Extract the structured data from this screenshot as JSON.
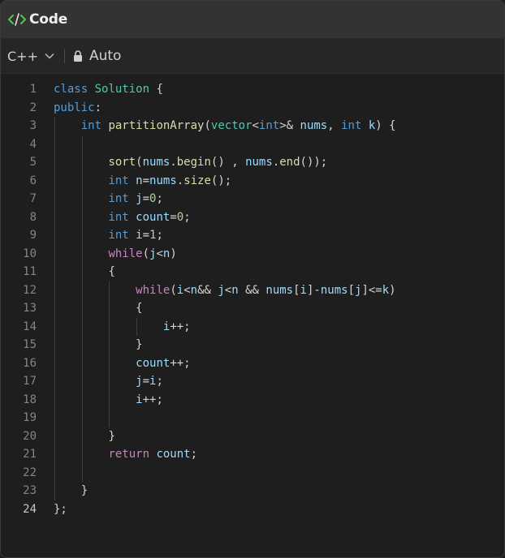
{
  "header": {
    "title": "Code",
    "icon": "code-icon"
  },
  "toolbar": {
    "language": "C++",
    "mode": "Auto"
  },
  "editor": {
    "active_line": 24,
    "lines": [
      {
        "n": "1",
        "indent": 0,
        "tokens": [
          [
            "kw",
            "class"
          ],
          [
            "pl",
            " "
          ],
          [
            "type",
            "Solution"
          ],
          [
            "pl",
            " {"
          ]
        ]
      },
      {
        "n": "2",
        "indent": 0,
        "tokens": [
          [
            "kw",
            "public"
          ],
          [
            "pl",
            ":"
          ]
        ]
      },
      {
        "n": "3",
        "indent": 1,
        "tokens": [
          [
            "kw",
            "int"
          ],
          [
            "pl",
            " "
          ],
          [
            "fn",
            "partitionArray"
          ],
          [
            "pl",
            "("
          ],
          [
            "type",
            "vector"
          ],
          [
            "pl",
            "<"
          ],
          [
            "kw",
            "int"
          ],
          [
            "pl",
            ">& "
          ],
          [
            "var",
            "nums"
          ],
          [
            "pl",
            ", "
          ],
          [
            "kw",
            "int"
          ],
          [
            "pl",
            " "
          ],
          [
            "var",
            "k"
          ],
          [
            "pl",
            ") {"
          ]
        ]
      },
      {
        "n": "4",
        "indent": 2,
        "tokens": []
      },
      {
        "n": "5",
        "indent": 2,
        "tokens": [
          [
            "fn",
            "sort"
          ],
          [
            "pl",
            "("
          ],
          [
            "var",
            "nums"
          ],
          [
            "pl",
            "."
          ],
          [
            "fn",
            "begin"
          ],
          [
            "pl",
            "() , "
          ],
          [
            "var",
            "nums"
          ],
          [
            "pl",
            "."
          ],
          [
            "fn",
            "end"
          ],
          [
            "pl",
            "());"
          ]
        ]
      },
      {
        "n": "6",
        "indent": 2,
        "tokens": [
          [
            "kw",
            "int"
          ],
          [
            "pl",
            " "
          ],
          [
            "var",
            "n"
          ],
          [
            "pl",
            "="
          ],
          [
            "var",
            "nums"
          ],
          [
            "pl",
            "."
          ],
          [
            "fn",
            "size"
          ],
          [
            "pl",
            "();"
          ]
        ]
      },
      {
        "n": "7",
        "indent": 2,
        "tokens": [
          [
            "kw",
            "int"
          ],
          [
            "pl",
            " "
          ],
          [
            "var",
            "j"
          ],
          [
            "pl",
            "="
          ],
          [
            "num",
            "0"
          ],
          [
            "pl",
            ";"
          ]
        ]
      },
      {
        "n": "8",
        "indent": 2,
        "tokens": [
          [
            "kw",
            "int"
          ],
          [
            "pl",
            " "
          ],
          [
            "var",
            "count"
          ],
          [
            "pl",
            "="
          ],
          [
            "num",
            "0"
          ],
          [
            "pl",
            ";"
          ]
        ]
      },
      {
        "n": "9",
        "indent": 2,
        "tokens": [
          [
            "kw",
            "int"
          ],
          [
            "pl",
            " "
          ],
          [
            "var",
            "i"
          ],
          [
            "pl",
            "="
          ],
          [
            "num",
            "1"
          ],
          [
            "pl",
            ";"
          ]
        ]
      },
      {
        "n": "10",
        "indent": 2,
        "tokens": [
          [
            "ctl",
            "while"
          ],
          [
            "pl",
            "("
          ],
          [
            "var",
            "j"
          ],
          [
            "pl",
            "<"
          ],
          [
            "var",
            "n"
          ],
          [
            "pl",
            ")"
          ]
        ]
      },
      {
        "n": "11",
        "indent": 2,
        "tokens": [
          [
            "pl",
            "{"
          ]
        ]
      },
      {
        "n": "12",
        "indent": 3,
        "tokens": [
          [
            "ctl",
            "while"
          ],
          [
            "pl",
            "("
          ],
          [
            "var",
            "i"
          ],
          [
            "pl",
            "<"
          ],
          [
            "var",
            "n"
          ],
          [
            "pl",
            "&& "
          ],
          [
            "var",
            "j"
          ],
          [
            "pl",
            "<"
          ],
          [
            "var",
            "n"
          ],
          [
            "pl",
            " && "
          ],
          [
            "var",
            "nums"
          ],
          [
            "pl",
            "["
          ],
          [
            "var",
            "i"
          ],
          [
            "pl",
            "]-"
          ],
          [
            "var",
            "nums"
          ],
          [
            "pl",
            "["
          ],
          [
            "var",
            "j"
          ],
          [
            "pl",
            "]<="
          ],
          [
            "var",
            "k"
          ],
          [
            "pl",
            ")"
          ]
        ]
      },
      {
        "n": "13",
        "indent": 3,
        "tokens": [
          [
            "pl",
            "{"
          ]
        ]
      },
      {
        "n": "14",
        "indent": 4,
        "tokens": [
          [
            "var",
            "i"
          ],
          [
            "pl",
            "++;"
          ]
        ]
      },
      {
        "n": "15",
        "indent": 3,
        "tokens": [
          [
            "pl",
            "}"
          ]
        ]
      },
      {
        "n": "16",
        "indent": 3,
        "tokens": [
          [
            "var",
            "count"
          ],
          [
            "pl",
            "++;"
          ]
        ]
      },
      {
        "n": "17",
        "indent": 3,
        "tokens": [
          [
            "var",
            "j"
          ],
          [
            "pl",
            "="
          ],
          [
            "var",
            "i"
          ],
          [
            "pl",
            ";"
          ]
        ]
      },
      {
        "n": "18",
        "indent": 3,
        "tokens": [
          [
            "var",
            "i"
          ],
          [
            "pl",
            "++;"
          ]
        ]
      },
      {
        "n": "19",
        "indent": 3,
        "tokens": []
      },
      {
        "n": "20",
        "indent": 2,
        "tokens": [
          [
            "pl",
            "}"
          ]
        ]
      },
      {
        "n": "21",
        "indent": 2,
        "tokens": [
          [
            "ctl",
            "return"
          ],
          [
            "pl",
            " "
          ],
          [
            "var",
            "count"
          ],
          [
            "pl",
            ";"
          ]
        ]
      },
      {
        "n": "22",
        "indent": 2,
        "tokens": []
      },
      {
        "n": "23",
        "indent": 1,
        "tokens": [
          [
            "pl",
            "}"
          ]
        ]
      },
      {
        "n": "24",
        "indent": 0,
        "tokens": [
          [
            "pl",
            "};"
          ]
        ]
      }
    ]
  },
  "colors": {
    "keyword": "#569cd6",
    "control": "#c586c0",
    "type": "#4ec9b0",
    "function": "#dcdcaa",
    "variable": "#9cdcfe",
    "number": "#b5cea8",
    "plain": "#d4d4d4",
    "icon_green": "#4ec94e"
  }
}
